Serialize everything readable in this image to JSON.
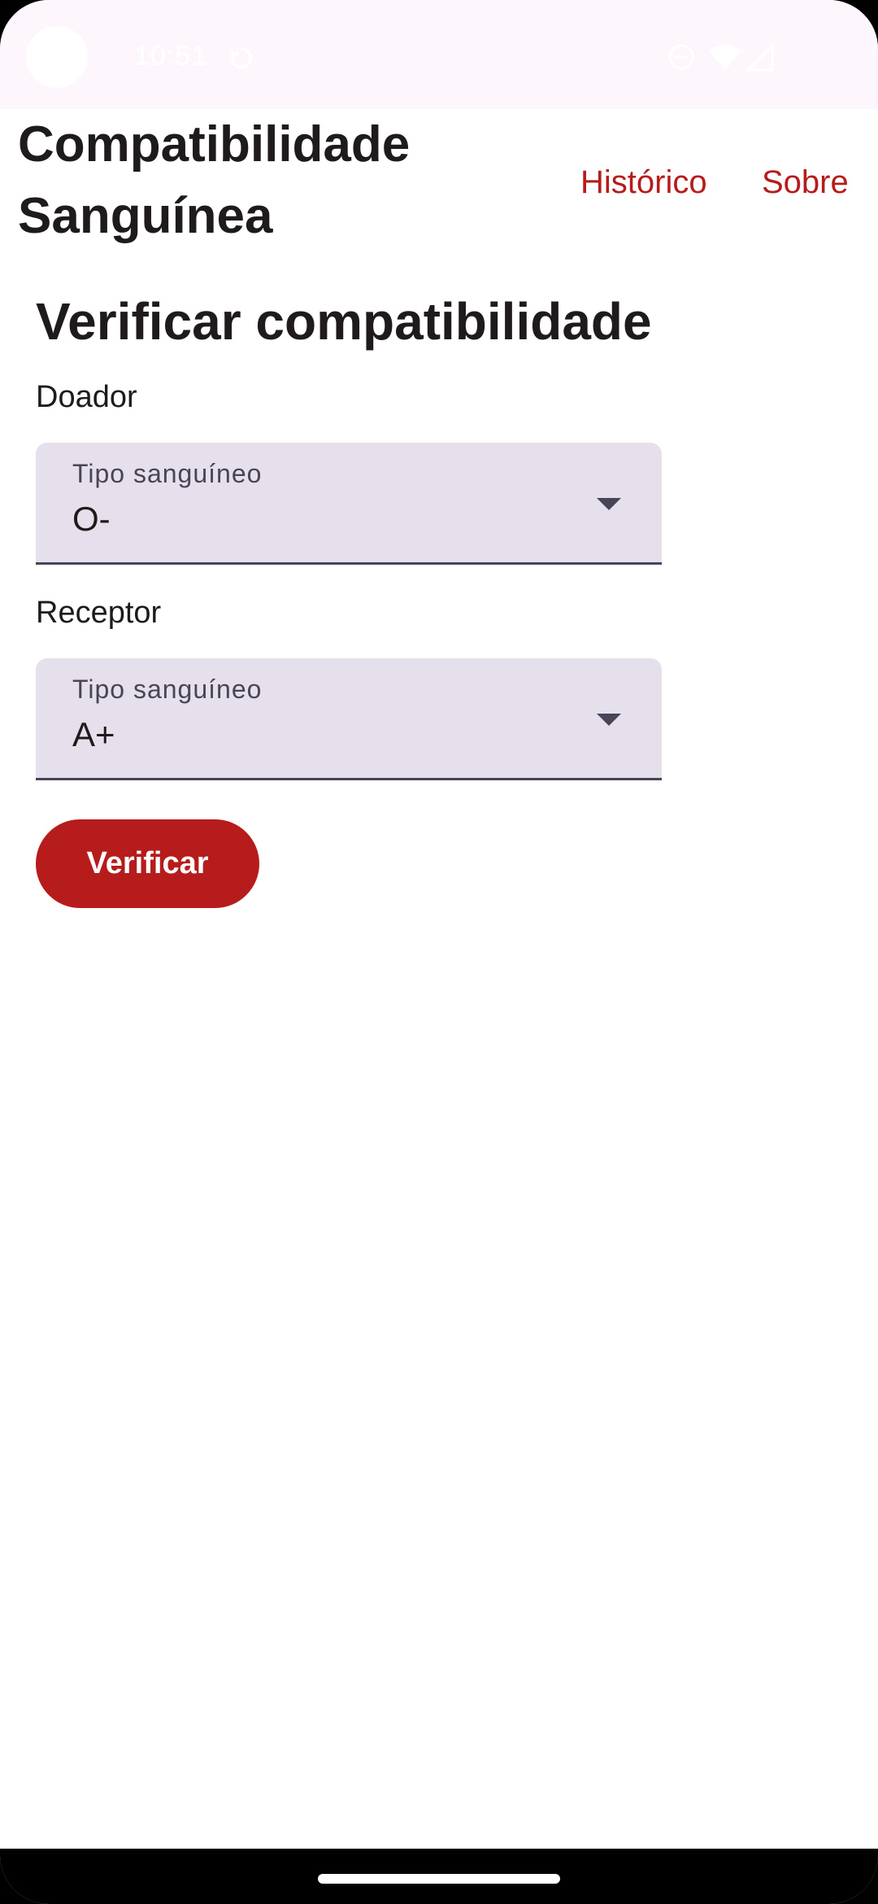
{
  "status_bar": {
    "time": "10:51"
  },
  "app_bar": {
    "title": "Compatibilidade Sanguínea",
    "nav": {
      "historico": "Histórico",
      "sobre": "Sobre"
    },
    "accent_color": "#b71c1c"
  },
  "main": {
    "heading": "Verificar compatibilidade",
    "donor": {
      "section_label": "Doador",
      "field_label": "Tipo sanguíneo",
      "value": "O-"
    },
    "recipient": {
      "section_label": "Receptor",
      "field_label": "Tipo sanguíneo",
      "value": "A+"
    },
    "verify_button": "Verificar"
  },
  "icons": {
    "status": [
      "sync-icon",
      "dnd-icon",
      "wifi-icon",
      "signal-icon"
    ],
    "dropdown": "arrow-drop-down-icon"
  }
}
